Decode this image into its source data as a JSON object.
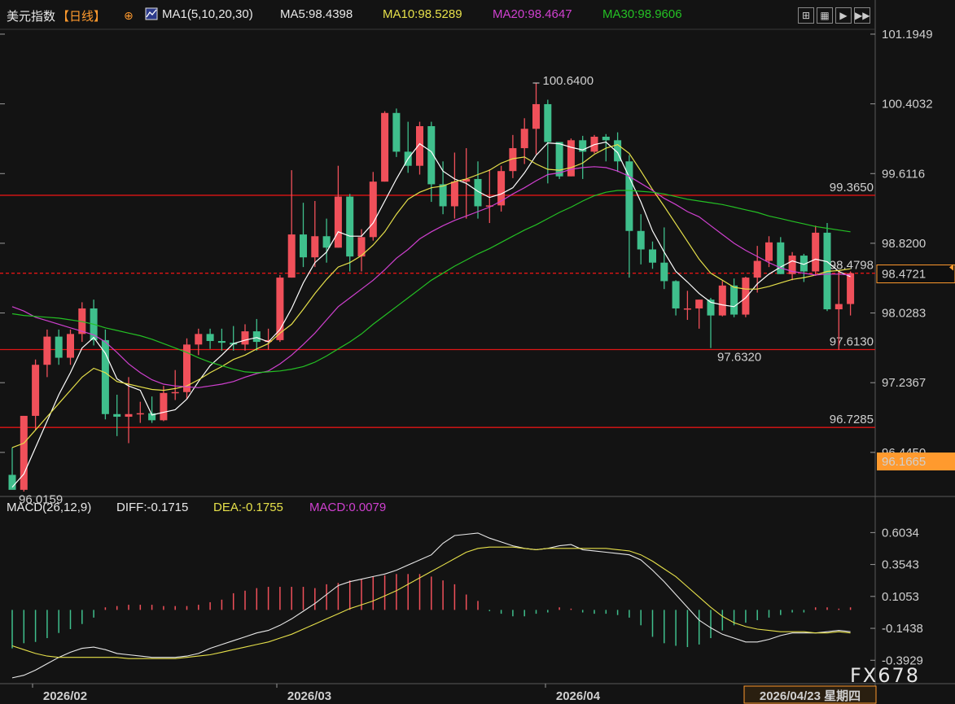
{
  "header": {
    "title": "美元指数",
    "period": "【日线】",
    "ma_params": "MA1(5,10,20,30)",
    "ma5": "MA5:98.4398",
    "ma10": "MA10:98.5289",
    "ma20": "MA20:98.4647",
    "ma30": "MA30:98.9606"
  },
  "macd_header": {
    "params": "MACD(26,12,9)",
    "diff": "DIFF:-0.1715",
    "dea": "DEA:-0.1755",
    "macd": "MACD:0.0079"
  },
  "toolbar": [
    "zoom-tool",
    "grid-tool",
    "play-tool",
    "fast-forward-tool"
  ],
  "watermark": "FX678",
  "colors": {
    "up": "#f0505a",
    "down": "#3fbf8c",
    "ma5": "#ffffff",
    "ma10": "#e6e04a",
    "ma20": "#cf40cf",
    "ma30": "#24c024",
    "hline": "#e01515",
    "accent": "#ff9a2e"
  },
  "chart_data": [
    {
      "type": "candlestick",
      "title": "美元指数 日线",
      "x_labels": [
        "2026/02",
        "2026/03",
        "2026/04"
      ],
      "cursor_date": "2026/04/23 星期四",
      "y_ticks": [
        "101.1949",
        "100.4032",
        "99.6116",
        "98.8200",
        "98.0283",
        "97.2367",
        "96.4450"
      ],
      "ylim": [
        96.0,
        101.25
      ],
      "current_price": "98.4721",
      "min_label": "96.1665",
      "annotations": [
        {
          "label": "100.6400",
          "value": 100.64
        },
        {
          "label": "96.0159",
          "value": 96.0159
        },
        {
          "label": "97.6320",
          "value": 97.632
        },
        {
          "label": "97.6130",
          "value": 97.613
        }
      ],
      "hlines": [
        {
          "label": "99.3650",
          "value": 99.365,
          "style": "solid"
        },
        {
          "label": "98.4798",
          "value": 98.4798,
          "style": "dashed"
        },
        {
          "label": "97.6130",
          "value": 97.613,
          "style": "solid"
        },
        {
          "label": "96.7285",
          "value": 96.7285,
          "style": "solid"
        }
      ],
      "candles": [
        [
          96.19,
          96.02,
          96.5,
          96.09
        ],
        [
          96.02,
          96.86,
          96.86,
          96.0
        ],
        [
          96.86,
          97.44,
          97.5,
          96.7
        ],
        [
          97.44,
          97.76,
          97.84,
          97.3
        ],
        [
          97.76,
          97.52,
          97.84,
          97.44
        ],
        [
          97.52,
          97.79,
          97.84,
          97.44
        ],
        [
          97.79,
          98.08,
          98.15,
          97.7
        ],
        [
          98.08,
          97.72,
          98.18,
          97.66
        ],
        [
          97.72,
          96.88,
          97.84,
          96.82
        ],
        [
          96.88,
          96.85,
          97.1,
          96.63
        ],
        [
          96.85,
          96.88,
          97.3,
          96.55
        ],
        [
          96.88,
          96.89,
          97.02,
          96.78
        ],
        [
          96.89,
          96.81,
          97.08,
          96.78
        ],
        [
          96.81,
          97.12,
          97.2,
          96.8
        ],
        [
          97.12,
          97.13,
          97.38,
          97.04
        ],
        [
          97.13,
          97.67,
          97.74,
          97.05
        ],
        [
          97.67,
          97.79,
          97.85,
          97.55
        ],
        [
          97.79,
          97.71,
          97.85,
          97.62
        ],
        [
          97.71,
          97.69,
          97.85,
          97.6
        ],
        [
          97.69,
          97.67,
          97.88,
          97.6
        ],
        [
          97.67,
          97.82,
          97.9,
          97.6
        ],
        [
          97.82,
          97.7,
          97.96,
          97.6
        ],
        [
          97.7,
          97.72,
          97.85,
          97.61
        ],
        [
          97.72,
          98.43,
          98.46,
          97.7
        ],
        [
          98.43,
          98.92,
          99.65,
          98.43
        ],
        [
          98.92,
          98.66,
          99.28,
          98.55
        ],
        [
          98.66,
          98.9,
          99.3,
          98.55
        ],
        [
          98.9,
          98.77,
          99.1,
          98.6
        ],
        [
          98.77,
          99.35,
          99.7,
          98.77
        ],
        [
          99.35,
          98.67,
          99.38,
          98.5
        ],
        [
          98.67,
          98.89,
          98.98,
          98.5
        ],
        [
          98.89,
          99.52,
          99.63,
          98.85
        ],
        [
          99.52,
          100.3,
          100.32,
          99.52
        ],
        [
          100.3,
          99.86,
          100.35,
          99.8
        ],
        [
          99.86,
          99.7,
          100.2,
          99.62
        ],
        [
          99.7,
          100.15,
          100.2,
          99.6
        ],
        [
          100.15,
          99.49,
          100.2,
          99.29
        ],
        [
          99.49,
          99.24,
          99.75,
          99.15
        ],
        [
          99.24,
          99.52,
          99.85,
          99.1
        ],
        [
          99.52,
          99.55,
          99.9,
          99.1
        ],
        [
          99.55,
          99.24,
          99.75,
          99.1
        ],
        [
          99.24,
          99.25,
          99.66,
          99.05
        ],
        [
          99.25,
          99.64,
          99.7,
          99.18
        ],
        [
          99.64,
          99.9,
          100.05,
          99.56
        ],
        [
          99.9,
          100.12,
          100.24,
          99.72
        ],
        [
          100.12,
          100.4,
          100.64,
          99.83
        ],
        [
          100.4,
          99.97,
          100.45,
          99.5
        ],
        [
          99.97,
          99.58,
          99.95,
          99.55
        ],
        [
          99.58,
          99.99,
          100.01,
          99.58
        ],
        [
          99.99,
          99.86,
          100.04,
          99.55
        ],
        [
          99.86,
          100.03,
          100.05,
          99.84
        ],
        [
          100.03,
          99.99,
          100.06,
          99.75
        ],
        [
          99.99,
          99.75,
          100.08,
          99.63
        ],
        [
          99.75,
          98.96,
          99.82,
          98.43
        ],
        [
          98.96,
          98.75,
          99.15,
          98.58
        ],
        [
          98.75,
          98.6,
          98.84,
          98.53
        ],
        [
          98.6,
          98.39,
          99.0,
          98.3
        ],
        [
          98.39,
          98.08,
          98.4,
          98.0
        ],
        [
          98.08,
          98.08,
          98.28,
          97.95
        ],
        [
          98.08,
          98.18,
          98.18,
          97.85
        ],
        [
          98.18,
          98.0,
          98.2,
          97.63
        ],
        [
          98.0,
          98.34,
          98.39,
          97.99
        ],
        [
          98.34,
          98.01,
          98.42,
          97.98
        ],
        [
          98.01,
          98.43,
          98.44,
          97.98
        ],
        [
          98.43,
          98.62,
          98.79,
          98.26
        ],
        [
          98.62,
          98.83,
          98.9,
          98.55
        ],
        [
          98.83,
          98.47,
          98.89,
          98.47
        ],
        [
          98.47,
          98.68,
          98.72,
          98.4
        ],
        [
          98.68,
          98.5,
          98.7,
          98.38
        ],
        [
          98.5,
          98.94,
          99.02,
          98.45
        ],
        [
          98.94,
          98.07,
          99.05,
          98.05
        ],
        [
          98.07,
          98.13,
          98.5,
          97.61
        ],
        [
          98.13,
          98.48,
          98.5,
          98.0
        ]
      ],
      "series": [
        {
          "name": "MA5",
          "values": [
            96.05,
            96.2,
            96.5,
            96.8,
            97.1,
            97.35,
            97.63,
            97.75,
            97.57,
            97.28,
            97.2,
            97.15,
            96.87,
            96.9,
            96.93,
            97.05,
            97.25,
            97.43,
            97.55,
            97.68,
            97.72,
            97.75,
            97.7,
            97.84,
            98.08,
            98.37,
            98.6,
            98.72,
            98.95,
            98.9,
            98.9,
            99.05,
            99.3,
            99.55,
            99.78,
            99.95,
            99.86,
            99.64,
            99.55,
            99.5,
            99.41,
            99.34,
            99.38,
            99.45,
            99.62,
            99.82,
            99.96,
            99.95,
            99.91,
            99.88,
            99.94,
            99.97,
            99.85,
            99.57,
            99.29,
            98.96,
            98.72,
            98.5,
            98.38,
            98.25,
            98.15,
            98.12,
            98.1,
            98.2,
            98.36,
            98.47,
            98.55,
            98.62,
            98.58,
            98.64,
            98.61,
            98.5,
            98.44
          ]
        },
        {
          "name": "MA10",
          "values": [
            96.5,
            96.55,
            96.7,
            96.85,
            97.0,
            97.15,
            97.3,
            97.4,
            97.35,
            97.25,
            97.22,
            97.19,
            97.16,
            97.15,
            97.17,
            97.2,
            97.27,
            97.35,
            97.42,
            97.5,
            97.55,
            97.62,
            97.68,
            97.8,
            97.9,
            98.07,
            98.25,
            98.41,
            98.55,
            98.6,
            98.68,
            98.8,
            98.95,
            99.15,
            99.32,
            99.4,
            99.45,
            99.47,
            99.52,
            99.55,
            99.6,
            99.65,
            99.73,
            99.78,
            99.8,
            99.72,
            99.66,
            99.65,
            99.68,
            99.73,
            99.83,
            99.9,
            99.94,
            99.84,
            99.64,
            99.43,
            99.24,
            99.04,
            98.84,
            98.64,
            98.48,
            98.4,
            98.32,
            98.3,
            98.3,
            98.33,
            98.37,
            98.41,
            98.43,
            98.46,
            98.5,
            98.51,
            98.53
          ]
        },
        {
          "name": "MA20",
          "values": [
            98.1,
            98.05,
            97.98,
            97.94,
            97.9,
            97.86,
            97.82,
            97.78,
            97.7,
            97.58,
            97.45,
            97.35,
            97.27,
            97.22,
            97.2,
            97.19,
            97.18,
            97.2,
            97.22,
            97.25,
            97.3,
            97.34,
            97.37,
            97.45,
            97.55,
            97.67,
            97.8,
            97.95,
            98.1,
            98.2,
            98.3,
            98.4,
            98.52,
            98.65,
            98.75,
            98.87,
            98.95,
            99.02,
            99.08,
            99.13,
            99.18,
            99.23,
            99.3,
            99.38,
            99.45,
            99.53,
            99.6,
            99.62,
            99.66,
            99.68,
            99.69,
            99.68,
            99.64,
            99.58,
            99.5,
            99.42,
            99.33,
            99.26,
            99.18,
            99.12,
            99.02,
            98.92,
            98.82,
            98.74,
            98.67,
            98.6,
            98.54,
            98.5,
            98.48,
            98.46,
            98.47,
            98.47,
            98.46
          ]
        },
        {
          "name": "MA30",
          "values": [
            98.02,
            98.0,
            97.99,
            97.98,
            97.97,
            97.95,
            97.93,
            97.9,
            97.86,
            97.83,
            97.8,
            97.77,
            97.73,
            97.68,
            97.63,
            97.58,
            97.52,
            97.47,
            97.43,
            97.39,
            97.36,
            97.35,
            97.36,
            97.37,
            97.39,
            97.42,
            97.47,
            97.54,
            97.62,
            97.7,
            97.79,
            97.9,
            98.0,
            98.1,
            98.2,
            98.3,
            98.4,
            98.48,
            98.56,
            98.63,
            98.7,
            98.76,
            98.83,
            98.9,
            98.97,
            99.03,
            99.1,
            99.17,
            99.23,
            99.3,
            99.36,
            99.4,
            99.42,
            99.42,
            99.41,
            99.4,
            99.38,
            99.35,
            99.32,
            99.3,
            99.28,
            99.26,
            99.23,
            99.2,
            99.17,
            99.13,
            99.1,
            99.07,
            99.04,
            99.01,
            98.99,
            98.97,
            98.95
          ]
        }
      ]
    },
    {
      "type": "macd",
      "title": "MACD(26,12,9)",
      "y_ticks": [
        "0.6034",
        "0.3543",
        "0.1053",
        "-0.1438",
        "-0.3929"
      ],
      "ylim": [
        -0.55,
        0.72
      ],
      "series": [
        {
          "name": "DIFF",
          "values": [
            -0.53,
            -0.51,
            -0.47,
            -0.42,
            -0.37,
            -0.33,
            -0.3,
            -0.29,
            -0.31,
            -0.34,
            -0.35,
            -0.36,
            -0.37,
            -0.37,
            -0.37,
            -0.36,
            -0.34,
            -0.3,
            -0.27,
            -0.24,
            -0.21,
            -0.18,
            -0.16,
            -0.12,
            -0.07,
            -0.01,
            0.05,
            0.12,
            0.19,
            0.22,
            0.24,
            0.26,
            0.28,
            0.31,
            0.35,
            0.39,
            0.43,
            0.52,
            0.58,
            0.59,
            0.6,
            0.56,
            0.53,
            0.5,
            0.48,
            0.47,
            0.48,
            0.5,
            0.51,
            0.47,
            0.46,
            0.45,
            0.44,
            0.43,
            0.39,
            0.31,
            0.22,
            0.12,
            0.02,
            -0.08,
            -0.14,
            -0.19,
            -0.22,
            -0.25,
            -0.25,
            -0.23,
            -0.2,
            -0.18,
            -0.18,
            -0.18,
            -0.17,
            -0.16,
            -0.17
          ]
        },
        {
          "name": "DEA",
          "values": [
            -0.28,
            -0.31,
            -0.34,
            -0.36,
            -0.37,
            -0.37,
            -0.37,
            -0.37,
            -0.37,
            -0.37,
            -0.38,
            -0.38,
            -0.38,
            -0.38,
            -0.38,
            -0.37,
            -0.36,
            -0.35,
            -0.33,
            -0.31,
            -0.29,
            -0.27,
            -0.25,
            -0.22,
            -0.19,
            -0.15,
            -0.11,
            -0.07,
            -0.03,
            0.01,
            0.04,
            0.07,
            0.11,
            0.15,
            0.2,
            0.25,
            0.3,
            0.35,
            0.4,
            0.45,
            0.48,
            0.49,
            0.49,
            0.49,
            0.48,
            0.47,
            0.48,
            0.48,
            0.48,
            0.48,
            0.48,
            0.48,
            0.47,
            0.46,
            0.43,
            0.38,
            0.32,
            0.26,
            0.18,
            0.1,
            0.02,
            -0.05,
            -0.1,
            -0.13,
            -0.15,
            -0.16,
            -0.17,
            -0.17,
            -0.17,
            -0.18,
            -0.18,
            -0.17,
            -0.18
          ]
        },
        {
          "name": "MACD",
          "values": [
            -0.3,
            -0.26,
            -0.25,
            -0.22,
            -0.18,
            -0.15,
            -0.11,
            -0.06,
            0.02,
            0.03,
            0.04,
            0.04,
            0.04,
            0.03,
            0.03,
            0.03,
            0.04,
            0.06,
            0.08,
            0.13,
            0.15,
            0.17,
            0.18,
            0.18,
            0.18,
            0.18,
            0.17,
            0.2,
            0.21,
            0.23,
            0.24,
            0.26,
            0.27,
            0.28,
            0.28,
            0.28,
            0.26,
            0.23,
            0.2,
            0.12,
            0.07,
            -0.01,
            -0.03,
            -0.05,
            -0.05,
            -0.03,
            -0.02,
            0.02,
            0.01,
            -0.02,
            -0.03,
            -0.03,
            -0.04,
            -0.06,
            -0.12,
            -0.21,
            -0.26,
            -0.28,
            -0.29,
            -0.27,
            -0.22,
            -0.16,
            -0.12,
            -0.1,
            -0.08,
            -0.06,
            -0.04,
            -0.02,
            -0.02,
            0.02,
            0.02,
            0.01,
            0.02
          ]
        }
      ]
    }
  ]
}
